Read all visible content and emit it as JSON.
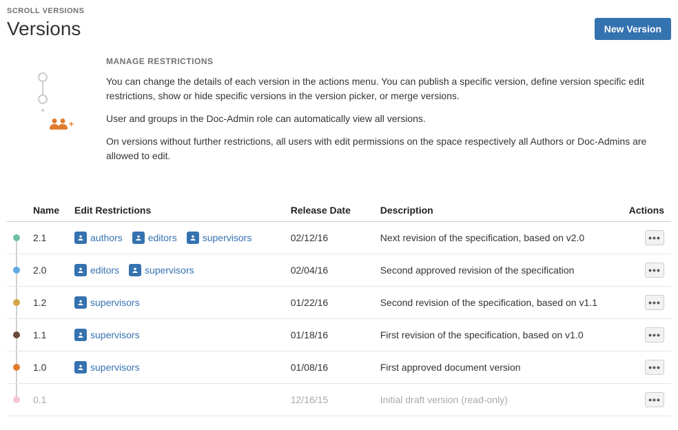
{
  "breadcrumb": "SCROLL VERSIONS",
  "page_title": "Versions",
  "new_version_btn": "New Version",
  "section_heading": "MANAGE RESTRICTIONS",
  "intro_p1": "You can change the details of each version in the actions menu. You can publish a specific version, define version specific edit restrictions, show or hide specific versions in the version picker, or merge versions.",
  "intro_p2": "User and groups in the Doc-Admin role can automatically view all versions.",
  "intro_p3": "On versions without further restrictions, all users with edit permissions on the space respectively all Authors or Doc-Admins are allowed to edit.",
  "columns": {
    "name": "Name",
    "restrictions": "Edit Restrictions",
    "release": "Release Date",
    "description": "Description",
    "actions": "Actions"
  },
  "dot_colors": [
    "#6fbfa9",
    "#5ea9e0",
    "#d6a549",
    "#6b4a3a",
    "#e07b2e",
    "#f4c7d2"
  ],
  "rows": [
    {
      "name": "2.1",
      "restrictions": [
        "authors",
        "editors",
        "supervisors"
      ],
      "release": "02/12/16",
      "description": "Next revision of the specification, based on v2.0",
      "muted": false
    },
    {
      "name": "2.0",
      "restrictions": [
        "editors",
        "supervisors"
      ],
      "release": "02/04/16",
      "description": "Second approved revision of the specification",
      "muted": false
    },
    {
      "name": "1.2",
      "restrictions": [
        "supervisors"
      ],
      "release": "01/22/16",
      "description": "Second revision of the specification, based on v1.1",
      "muted": false
    },
    {
      "name": "1.1",
      "restrictions": [
        "supervisors"
      ],
      "release": "01/18/16",
      "description": "First revision of the specification, based on v1.0",
      "muted": false
    },
    {
      "name": "1.0",
      "restrictions": [
        "supervisors"
      ],
      "release": "01/08/16",
      "description": "First approved document version",
      "muted": false
    },
    {
      "name": "0.1",
      "restrictions": [],
      "release": "12/16/15",
      "description": "Initial draft version (read-only)",
      "muted": true
    }
  ]
}
